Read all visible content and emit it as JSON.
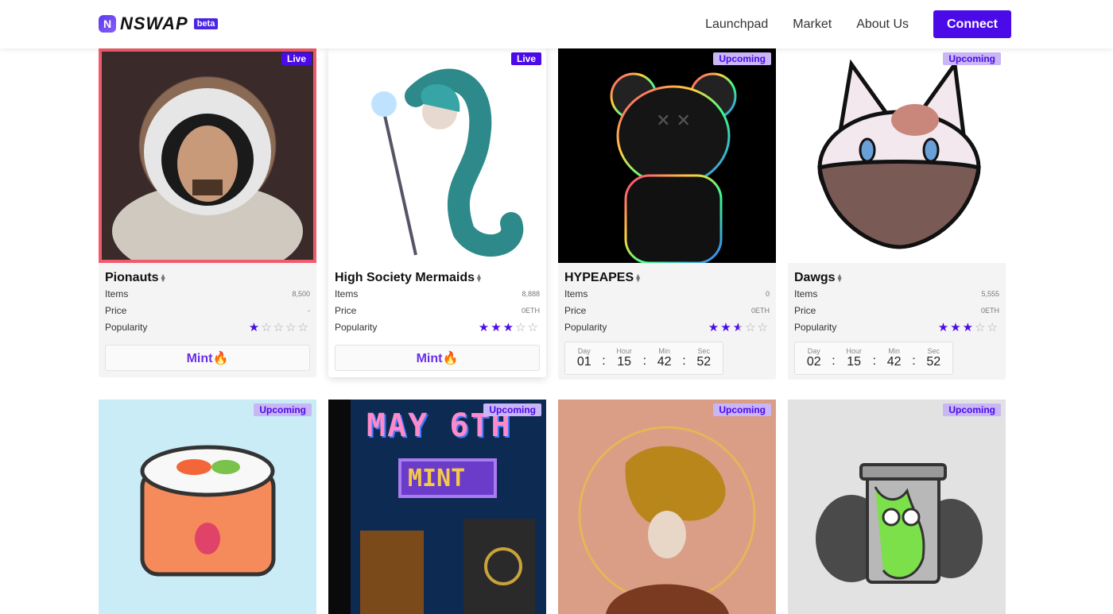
{
  "header": {
    "logo_mark": "N",
    "logo_text": "NSWAP",
    "badge": "beta",
    "nav": [
      "Launchpad",
      "Market",
      "About Us"
    ],
    "connect": "Connect"
  },
  "cards": [
    {
      "name": "Pionauts",
      "status": "Live",
      "items": "8,500",
      "price": "-",
      "stars": [
        1,
        0,
        0,
        0,
        0
      ],
      "action": "Mint🔥"
    },
    {
      "name": "High Society Mermaids",
      "status": "Live",
      "items": "8,888",
      "price": "0ETH",
      "stars": [
        1,
        1,
        1,
        0,
        0
      ],
      "action": "Mint🔥"
    },
    {
      "name": "HYPEAPES",
      "status": "Upcoming",
      "items": "0",
      "price": "0ETH",
      "stars": [
        1,
        1,
        0.5,
        0,
        0
      ],
      "countdown": {
        "day": "01",
        "hour": "15",
        "min": "42",
        "sec": "52"
      }
    },
    {
      "name": "Dawgs",
      "status": "Upcoming",
      "items": "5,555",
      "price": "0ETH",
      "stars": [
        1,
        1,
        1,
        0,
        0
      ],
      "countdown": {
        "day": "02",
        "hour": "15",
        "min": "42",
        "sec": "52"
      }
    },
    {
      "name": "",
      "status": "Upcoming"
    },
    {
      "name": "",
      "status": "Upcoming",
      "art_text": [
        "MAY 6TH",
        "MINT"
      ]
    },
    {
      "name": "",
      "status": "Upcoming"
    },
    {
      "name": "",
      "status": "Upcoming"
    }
  ],
  "labels": {
    "items": "Items",
    "price": "Price",
    "popularity": "Popularity",
    "day": "Day",
    "hour": "Hour",
    "min": "Min",
    "sec": "Sec",
    "eth_symbol": "⧫"
  }
}
